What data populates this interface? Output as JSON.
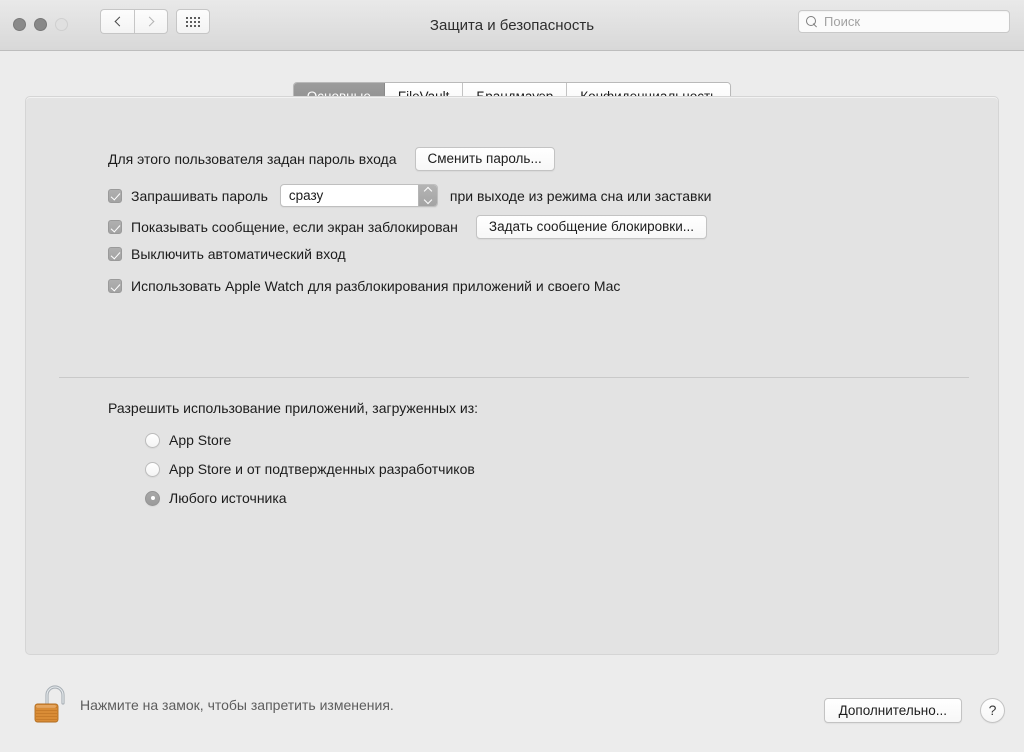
{
  "window": {
    "title": "Защита и безопасность",
    "traffic_lights": [
      "close",
      "minimize",
      "zoom"
    ],
    "nav": {
      "back_icon": "chevron-left-icon",
      "forward_icon": "chevron-right-icon"
    },
    "grid_button_icon": "grid-apps-icon"
  },
  "search": {
    "placeholder": "Поиск",
    "value": "",
    "icon": "search-icon"
  },
  "tabs": [
    {
      "label": "Основные",
      "selected": true
    },
    {
      "label": "FileVault",
      "selected": false
    },
    {
      "label": "Брандмауэр",
      "selected": false
    },
    {
      "label": "Конфиденциальность",
      "selected": false
    }
  ],
  "general": {
    "password_set_label": "Для этого пользователя задан пароль входа",
    "change_password_button": "Сменить пароль...",
    "require_password": {
      "checked": true,
      "label_before": "Запрашивать пароль",
      "popup_value": "сразу",
      "popup_options": [
        "сразу"
      ],
      "label_after": "при выходе из режима сна или заставки"
    },
    "show_message": {
      "checked": true,
      "label": "Показывать сообщение, если экран заблокирован",
      "button": "Задать сообщение блокировки..."
    },
    "disable_auto_login": {
      "checked": true,
      "label": "Выключить автоматический вход"
    },
    "use_apple_watch": {
      "checked": true,
      "label": "Использовать Apple Watch для разблокирования приложений и своего Mac"
    }
  },
  "gatekeeper": {
    "heading": "Разрешить использование приложений, загруженных из:",
    "options": [
      {
        "label": "App Store",
        "selected": false
      },
      {
        "label": "App Store и от подтвержденных разработчиков",
        "selected": false
      },
      {
        "label": "Любого источника",
        "selected": true
      }
    ]
  },
  "bottom": {
    "lock_icon": "padlock-open-icon",
    "lock_message": "Нажмите на замок, чтобы запретить изменения.",
    "advanced_button": "Дополнительно...",
    "help_button": "?"
  },
  "colors": {
    "window_bg": "#ececec",
    "panel_bg": "#e3e3e3",
    "selected_tab_bg": "#949494",
    "lock_body": "#d98c36",
    "text": "#1c1c1c"
  }
}
